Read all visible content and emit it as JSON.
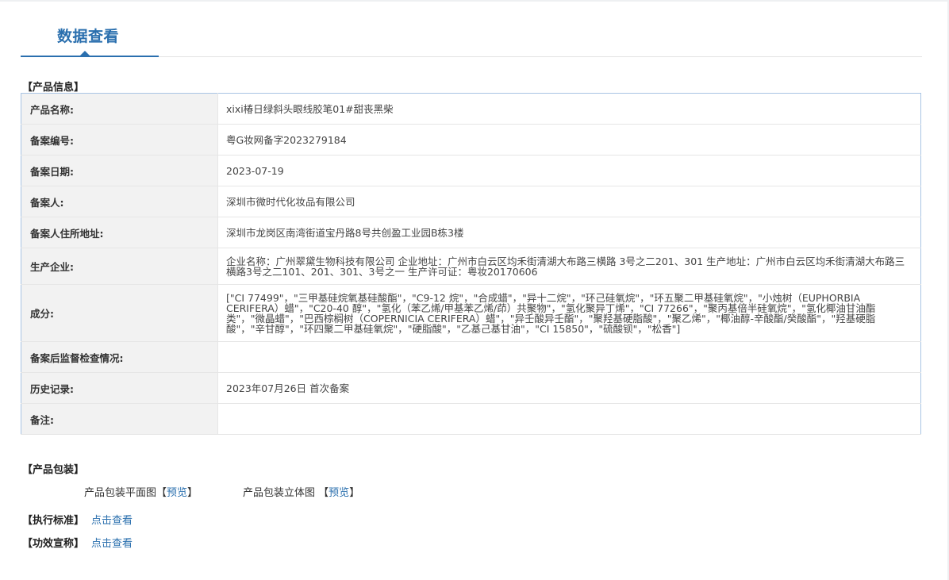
{
  "tab": {
    "title": "数据查看"
  },
  "product_info": {
    "section_title": "【产品信息】",
    "rows": [
      {
        "label": "产品名称:",
        "value": "xixi椿日绿斜头眼线胶笔01#甜丧黑柴"
      },
      {
        "label": "备案编号:",
        "value": "粤G妆网备字2023279184"
      },
      {
        "label": "备案日期:",
        "value": "2023-07-19"
      },
      {
        "label": "备案人:",
        "value": "深圳市微时代化妆品有限公司"
      },
      {
        "label": "备案人住所地址:",
        "value": "深圳市龙岗区南湾街道宝丹路8号共创盈工业园B栋3楼"
      },
      {
        "label": "生产企业:",
        "value": "企业名称：广州翠黛生物科技有限公司 企业地址：广州市白云区均禾街清湖大布路三横路 3号之二201、301 生产地址：广州市白云区均禾街清湖大布路三横路3号之二101、201、301、3号之一 生产许可证：粤妆20170606"
      },
      {
        "label": "成分:",
        "value": "[\"CI 77499\"，\"三甲基硅烷氧基硅酸酯\"，\"C9-12 烷\"，\"合成蜡\"，\"异十二烷\"，\"环己硅氧烷\"，\"环五聚二甲基硅氧烷\"，\"小烛树（EUPHORBIA CERIFERA）蜡\"，\"C20-40 醇\"，\"氢化（苯乙烯/甲基苯乙烯/茚）共聚物\"，\"氢化聚异丁烯\"，\"CI 77266\"，\"聚丙基倍半硅氧烷\"，\"氢化椰油甘油酯类\"，\"微晶蜡\"，\"巴西棕榈树（COPERNICIA CERIFERA）蜡\"，\"异壬酸异壬酯\"，\"聚羟基硬脂酸\"，\"聚乙烯\"，\"椰油醇-辛酸酯/癸酸酯\"，\"羟基硬脂酸\"，\"辛甘醇\"，\"环四聚二甲基硅氧烷\"，\"硬脂酸\"，\"乙基己基甘油\"，\"CI 15850\"，\"硫酸钡\"，\"松香\"]"
      },
      {
        "label": "备案后监督检查情况:",
        "value": ""
      },
      {
        "label": "历史记录:",
        "value": "2023年07月26日 首次备案"
      },
      {
        "label": "备注:",
        "value": ""
      }
    ]
  },
  "packaging": {
    "section_title": "【产品包装】",
    "flat_label": "产品包装平面图",
    "solid_label": "产品包装立体图",
    "preview_link": "预览",
    "bracket_open": "【",
    "bracket_close": "】"
  },
  "standard": {
    "section_title": "【执行标准】",
    "link": "点击查看"
  },
  "efficacy": {
    "section_title": "【功效宣称】",
    "link": "点击查看"
  }
}
